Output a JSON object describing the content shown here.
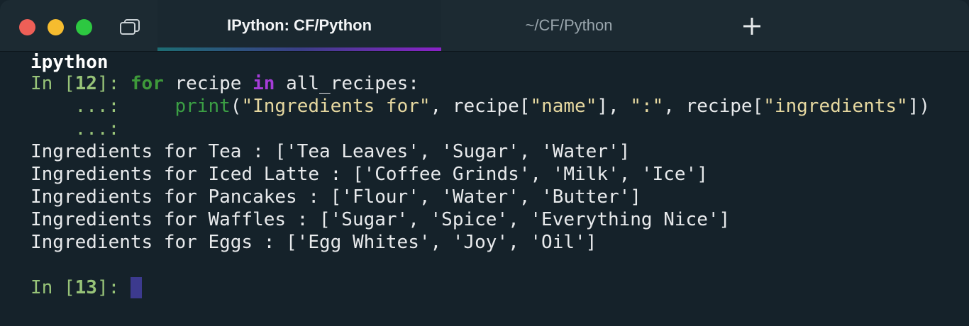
{
  "window": {
    "traffic_lights": {
      "close_color": "#ee5f57",
      "minimize_color": "#f6bc2f",
      "maximize_color": "#2dc841"
    },
    "tabs": [
      {
        "label": "IPython: CF/Python",
        "active": true
      },
      {
        "label": "~/CF/Python",
        "active": false
      }
    ],
    "icons": {
      "tab_overview": "tab-overview-icon",
      "new_tab": "plus-icon"
    }
  },
  "terminal": {
    "command": "ipython",
    "input_12": {
      "prompt_in": "In [",
      "prompt_num": "12",
      "prompt_end": "]: ",
      "kw_for": "for",
      "var_recipe": " recipe ",
      "kw_in": "in",
      "iter": " all_recipes:",
      "cont_prompt": "    ...:     ",
      "print_fn": "print",
      "open_paren": "(",
      "str_ingredients_for": "\"Ingredients for\"",
      "sep1": ", recipe[",
      "str_name": "\"name\"",
      "sep2": "], ",
      "str_colon": "\":\"",
      "sep3": ", recipe[",
      "str_ingredients": "\"ingredients\"",
      "close": "])",
      "cont_prompt_empty": "    ...:"
    },
    "output": [
      "Ingredients for Tea : ['Tea Leaves', 'Sugar', 'Water']",
      "Ingredients for Iced Latte : ['Coffee Grinds', 'Milk', 'Ice']",
      "Ingredients for Pancakes : ['Flour', 'Water', 'Butter']",
      "Ingredients for Waffles : ['Sugar', 'Spice', 'Everything Nice']",
      "Ingredients for Eggs : ['Egg Whites', 'Joy', 'Oil']"
    ],
    "input_13": {
      "prompt_in": "In [",
      "prompt_num": "13",
      "prompt_end": "]: "
    },
    "colors": {
      "background": "#15222a",
      "prompt": "#97c378",
      "keyword_for": "#3e9a3a",
      "keyword_in": "#a63cd8",
      "string": "#e6d8a0",
      "cursor": "#3c3a8e"
    }
  }
}
